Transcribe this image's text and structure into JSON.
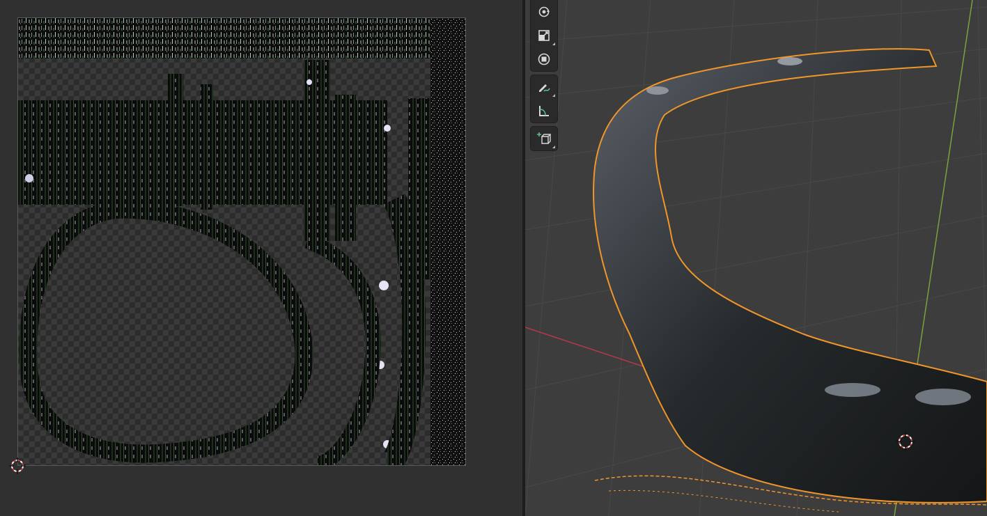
{
  "uv_editor": {
    "image_icon": "texture-image",
    "cursor_icon": "2d-cursor-icon"
  },
  "viewport": {
    "tools": [
      {
        "name": "rotate-tool",
        "icon": "rotate-icon"
      },
      {
        "name": "scale-tool",
        "icon": "scale-icon"
      },
      {
        "name": "transform-tool",
        "icon": "transform-icon"
      },
      {
        "name": "annotate-tool",
        "icon": "annotate-pencil-icon"
      },
      {
        "name": "measure-tool",
        "icon": "measure-ruler-icon"
      },
      {
        "name": "add-cube-tool",
        "icon": "add-cube-icon"
      }
    ],
    "selection_outline_color": "#f0962a",
    "x_axis_color": "#b8384a",
    "y_axis_color": "#7aa33a",
    "grid_color": "#4a4a4a",
    "cursor_icon": "3d-cursor-icon"
  }
}
